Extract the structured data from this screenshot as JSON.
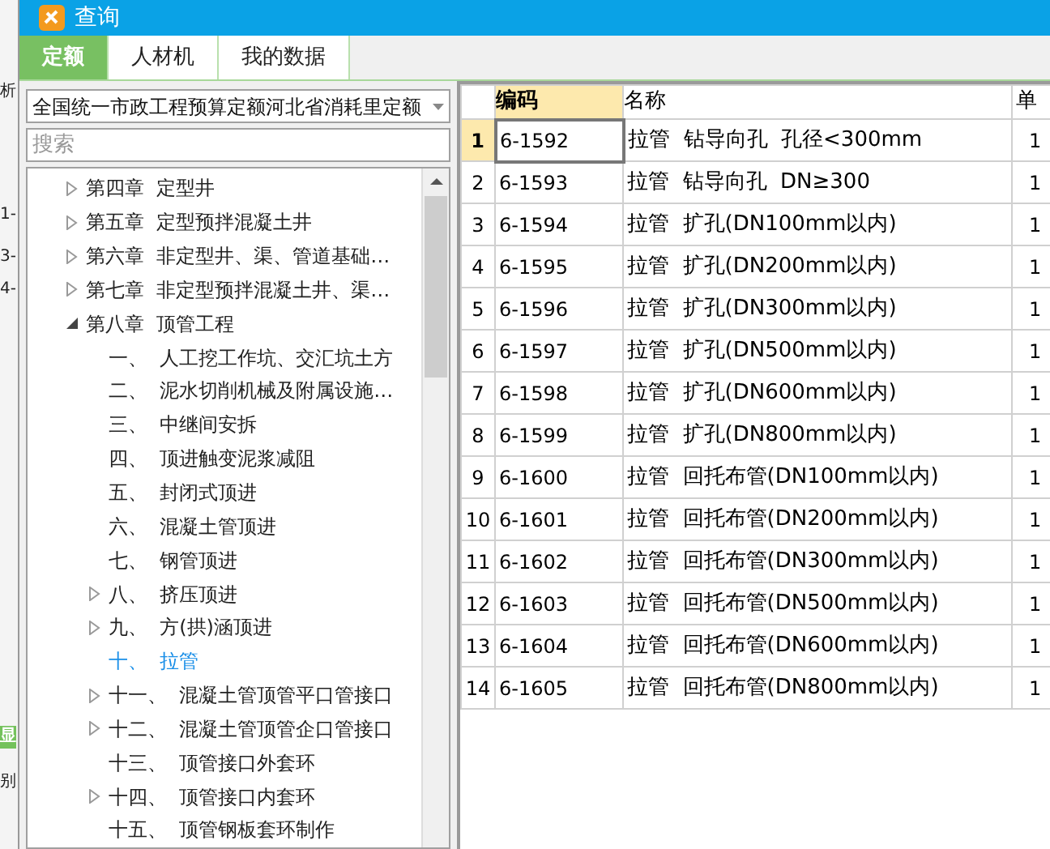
{
  "background_fragments": [
    {
      "text": "析",
      "kind": "plain"
    },
    {
      "text": "1-",
      "kind": "plain"
    },
    {
      "text": "3-",
      "kind": "plain"
    },
    {
      "text": "4-",
      "kind": "plain"
    },
    {
      "text": "显",
      "kind": "green"
    },
    {
      "text": "别",
      "kind": "plain"
    }
  ],
  "window": {
    "title": "查询"
  },
  "tabs": [
    {
      "label": "定额",
      "selected": true
    },
    {
      "label": "人材机",
      "selected": false
    },
    {
      "label": "我的数据",
      "selected": false
    }
  ],
  "library_dropdown": {
    "value": "全国统一市政工程预算定额河北省消耗里定额"
  },
  "search": {
    "placeholder": "搜索"
  },
  "tree": [
    {
      "label": "第四章  定型井",
      "kind": "collapsed",
      "selected": false
    },
    {
      "label": "第五章  定型预拌混凝土井",
      "kind": "collapsed",
      "selected": false
    },
    {
      "label": "第六章  非定型井、渠、管道基础…",
      "kind": "collapsed",
      "selected": false
    },
    {
      "label": "第七章  非定型预拌混凝土井、渠…",
      "kind": "collapsed",
      "selected": false
    },
    {
      "label": "第八章  顶管工程",
      "kind": "expanded",
      "selected": false,
      "children": [
        {
          "label": "一、  人工挖工作坑、交汇坑土方",
          "kind": "leaf",
          "selected": false
        },
        {
          "label": "二、  泥水切削机械及附属设施…",
          "kind": "leaf",
          "selected": false
        },
        {
          "label": "三、  中继间安拆",
          "kind": "leaf",
          "selected": false
        },
        {
          "label": "四、  顶进触变泥浆减阻",
          "kind": "leaf",
          "selected": false
        },
        {
          "label": "五、  封闭式顶进",
          "kind": "leaf",
          "selected": false
        },
        {
          "label": "六、  混凝土管顶进",
          "kind": "leaf",
          "selected": false
        },
        {
          "label": "七、  钢管顶进",
          "kind": "leaf",
          "selected": false
        },
        {
          "label": "八、  挤压顶进",
          "kind": "collapsed",
          "selected": false
        },
        {
          "label": "九、  方(拱)涵顶进",
          "kind": "collapsed",
          "selected": false
        },
        {
          "label": "十、  拉管",
          "kind": "leaf",
          "selected": true
        },
        {
          "label": "十一、  混凝土管顶管平口管接口",
          "kind": "collapsed",
          "selected": false
        },
        {
          "label": "十二、  混凝土管顶管企口管接口",
          "kind": "collapsed",
          "selected": false
        },
        {
          "label": "十三、  顶管接口外套环",
          "kind": "leaf",
          "selected": false
        },
        {
          "label": "十四、  顶管接口内套环",
          "kind": "collapsed",
          "selected": false
        },
        {
          "label": "十五、  顶管钢板套环制作",
          "kind": "leaf",
          "selected": false
        }
      ]
    }
  ],
  "table": {
    "columns": [
      {
        "label": "编码",
        "selected": true
      },
      {
        "label": "名称",
        "selected": false
      },
      {
        "label": "单",
        "selected": false
      }
    ],
    "rows": [
      {
        "num": "1",
        "code": "6-1592",
        "name": "拉管  钻导向孔  孔径<300mm",
        "unit": "1",
        "selected": true
      },
      {
        "num": "2",
        "code": "6-1593",
        "name": "拉管  钻导向孔  DN≥300",
        "unit": "1",
        "selected": false
      },
      {
        "num": "3",
        "code": "6-1594",
        "name": "拉管  扩孔(DN100mm以内)",
        "unit": "1",
        "selected": false
      },
      {
        "num": "4",
        "code": "6-1595",
        "name": "拉管  扩孔(DN200mm以内)",
        "unit": "1",
        "selected": false
      },
      {
        "num": "5",
        "code": "6-1596",
        "name": "拉管  扩孔(DN300mm以内)",
        "unit": "1",
        "selected": false
      },
      {
        "num": "6",
        "code": "6-1597",
        "name": "拉管  扩孔(DN500mm以内)",
        "unit": "1",
        "selected": false
      },
      {
        "num": "7",
        "code": "6-1598",
        "name": "拉管  扩孔(DN600mm以内)",
        "unit": "1",
        "selected": false
      },
      {
        "num": "8",
        "code": "6-1599",
        "name": "拉管  扩孔(DN800mm以内)",
        "unit": "1",
        "selected": false
      },
      {
        "num": "9",
        "code": "6-1600",
        "name": "拉管  回托布管(DN100mm以内)",
        "unit": "1",
        "selected": false
      },
      {
        "num": "10",
        "code": "6-1601",
        "name": "拉管  回托布管(DN200mm以内)",
        "unit": "1",
        "selected": false
      },
      {
        "num": "11",
        "code": "6-1602",
        "name": "拉管  回托布管(DN300mm以内)",
        "unit": "1",
        "selected": false
      },
      {
        "num": "12",
        "code": "6-1603",
        "name": "拉管  回托布管(DN500mm以内)",
        "unit": "1",
        "selected": false
      },
      {
        "num": "13",
        "code": "6-1604",
        "name": "拉管  回托布管(DN600mm以内)",
        "unit": "1",
        "selected": false
      },
      {
        "num": "14",
        "code": "6-1605",
        "name": "拉管  回托布管(DN800mm以内)",
        "unit": "1",
        "selected": false
      }
    ]
  }
}
